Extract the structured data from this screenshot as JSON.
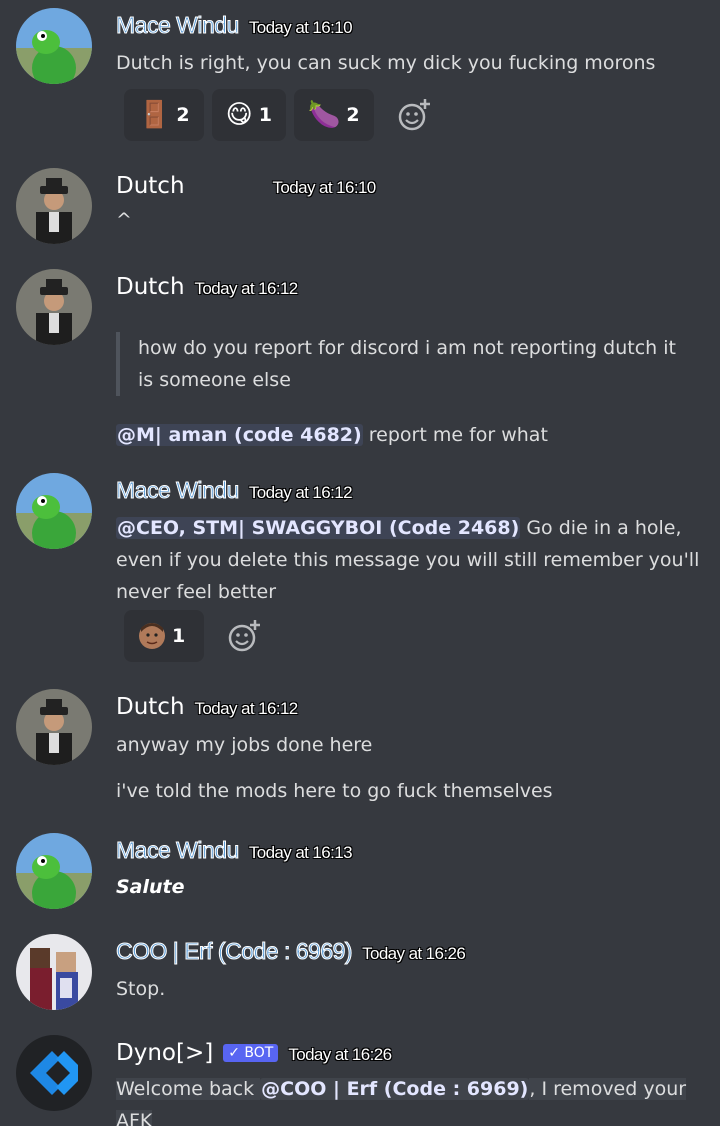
{
  "messages": [
    {
      "author": "Mace Windu",
      "timestamp": "Today at 16:10",
      "lines": [
        "Dutch is right, you can suck my dick you fucking morons"
      ],
      "reactions": [
        {
          "emoji": "🚪",
          "count": "2"
        },
        {
          "emoji": "😋",
          "count": "1"
        },
        {
          "emoji": "🍆",
          "count": "2"
        }
      ]
    },
    {
      "author": "Dutch",
      "timestamp": "Today at 16:10",
      "lines": [
        "^"
      ]
    },
    {
      "author": "Dutch",
      "timestamp": "Today at 16:12",
      "quote": "how do you report for discord i am not reporting dutch it is someone else",
      "mention": "@M| aman (code 4682)",
      "text_after_mention": " report me for what"
    },
    {
      "author": "Mace Windu",
      "timestamp": "Today at 16:12",
      "mention": "@CEO, STM| SWAGGYBOI (Code 2468)",
      "text_after_mention": " Go die in a hole, even if you delete this message you will still remember you'll never feel better",
      "reactions": [
        {
          "emoji": "face-emoji",
          "count": "1"
        }
      ]
    },
    {
      "author": "Dutch",
      "timestamp": "Today at 16:12",
      "lines": [
        "anyway my jobs done here",
        "i've told the mods here to go fuck themselves"
      ]
    },
    {
      "author": "Mace Windu",
      "timestamp": "Today at 16:13",
      "lines": [
        "Salute"
      ]
    },
    {
      "author": "COO | Erf (Code : 6969)",
      "timestamp": "Today at 16:26",
      "lines": [
        "Stop."
      ]
    },
    {
      "author": "Dyno[>]",
      "bot_tag": "✓ BOT",
      "timestamp": "Today at 16:26",
      "text_before": "Welcome back ",
      "mention": "@COO | Erf (Code : 6969)",
      "text_after_mention": ", I removed your AFK"
    }
  ],
  "colors": {
    "background": "#36393f",
    "reaction_bg": "#2f3136",
    "mention_text": "#e3e6ff",
    "bot_tag": "#5865f2"
  }
}
